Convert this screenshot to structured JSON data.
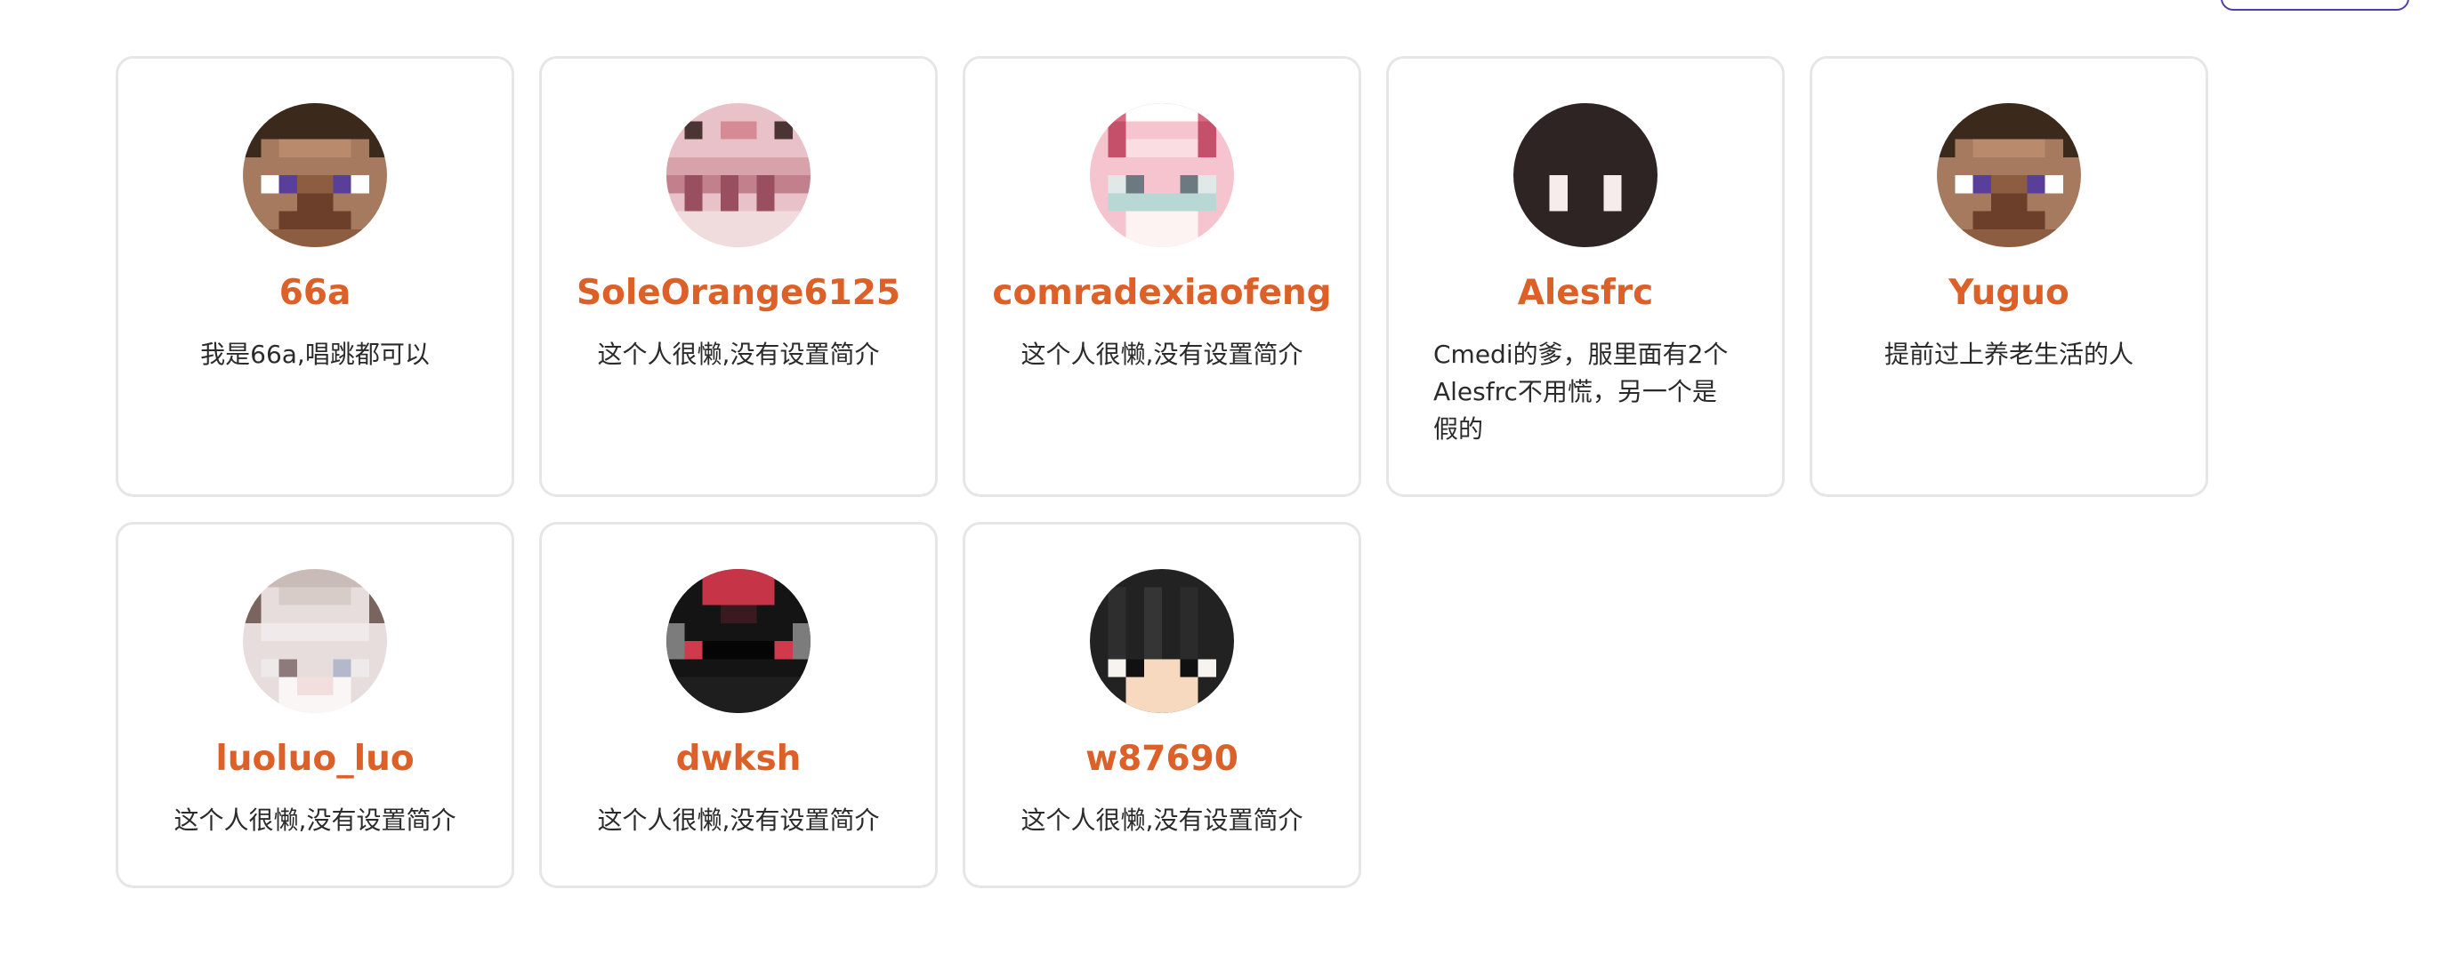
{
  "users": [
    {
      "name": "66a",
      "bio": "我是66a,唱跳都可以"
    },
    {
      "name": "SoleOrange6125",
      "bio": "这个人很懒,没有设置简介"
    },
    {
      "name": "comradexiaofeng",
      "bio": "这个人很懒,没有设置简介"
    },
    {
      "name": "Alesfrc",
      "bio": "Cmedi的爹，服里面有2个Alesfrc不用慌，另一个是假的"
    },
    {
      "name": "Yuguo",
      "bio": "提前过上养老生活的人"
    },
    {
      "name": "luoluo_luo",
      "bio": "这个人很懒,没有设置简介"
    },
    {
      "name": "dwksh",
      "bio": "这个人很懒,没有设置简介"
    },
    {
      "name": "w87690",
      "bio": "这个人很懒,没有设置简介"
    }
  ],
  "colors": {
    "name": "#dc6028",
    "card_border": "#e6e6e6",
    "top_button_border": "#4b3fae"
  }
}
